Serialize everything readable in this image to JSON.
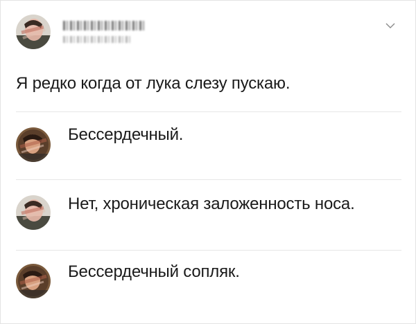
{
  "post": {
    "text": "Я редко когда от лука слезу пускаю."
  },
  "comments": [
    {
      "text": "Бессердечный."
    },
    {
      "text": "Нет, хроническая заложенность носа."
    },
    {
      "text": "Бессердечный сопляк."
    }
  ],
  "icons": {
    "menu": "chevron-down-icon",
    "avatar": "avatar-image"
  },
  "colors": {
    "divider": "#e6e6e6",
    "text": "#1a1a1a",
    "avatar_bg": "#8a6a48"
  }
}
